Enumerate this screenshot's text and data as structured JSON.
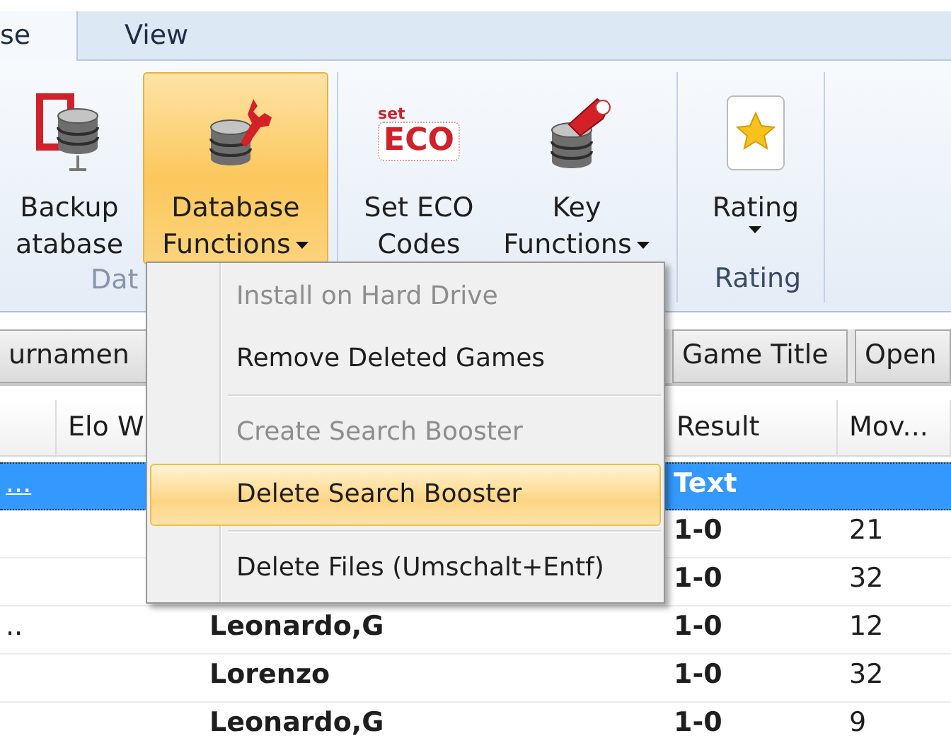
{
  "ribbon": {
    "tabs": [
      {
        "label": "se",
        "selected": true
      },
      {
        "label": "View",
        "selected": false
      }
    ],
    "groups": [
      {
        "label": "Dat",
        "buttons": [
          {
            "lines": [
              "Backup",
              "atabase"
            ],
            "dropdown": false,
            "pressed": false
          },
          {
            "lines": [
              "Database",
              "Functions"
            ],
            "dropdown": true,
            "pressed": true
          }
        ]
      },
      {
        "buttons": [
          {
            "lines": [
              "Set ECO",
              "Codes"
            ],
            "dropdown": false,
            "pressed": false,
            "icon_caption": "set",
            "icon_text": "ECO"
          },
          {
            "lines": [
              "Key",
              "Functions"
            ],
            "dropdown": true,
            "pressed": false
          }
        ]
      },
      {
        "label": "Rating",
        "buttons": [
          {
            "lines": [
              "Rating"
            ],
            "dropdown": true,
            "pressed": false
          }
        ]
      }
    ]
  },
  "field_buttons": [
    {
      "label": "urnamen"
    },
    {
      "label": "Game Title"
    },
    {
      "label": "Open"
    }
  ],
  "table": {
    "columns": [
      {
        "label": "Elo W"
      },
      {
        "label": "Result"
      },
      {
        "label": "Mov..."
      }
    ],
    "rows": [
      {
        "column_1": "...",
        "result": "Text",
        "selected": true
      },
      {
        "result": "1-0",
        "moves": "21",
        "selected": false
      },
      {
        "result": "1-0",
        "moves": "32",
        "selected": false
      },
      {
        "column_1": "..",
        "column_3": "Leonardo,G",
        "result": "1-0",
        "moves": "12",
        "selected": false
      },
      {
        "column_3": "Lorenzo",
        "result": "1-0",
        "moves": "32",
        "selected": false
      },
      {
        "column_3": "Leonardo,G",
        "result": "1-0",
        "moves": "9",
        "selected": false
      }
    ]
  },
  "menu": {
    "items": [
      {
        "kind": "item",
        "label": "Install on Hard Drive",
        "disabled": true,
        "selected": false
      },
      {
        "kind": "item",
        "label": "Remove Deleted Games",
        "disabled": false,
        "selected": false
      },
      {
        "kind": "separator"
      },
      {
        "kind": "item",
        "label": "Create Search Booster",
        "disabled": true,
        "selected": false
      },
      {
        "kind": "item",
        "label": "Delete Search Booster",
        "disabled": false,
        "selected": true
      },
      {
        "kind": "separator"
      },
      {
        "kind": "item",
        "label": "Delete Files (Umschalt+Entf)",
        "disabled": false,
        "selected": false
      }
    ]
  }
}
